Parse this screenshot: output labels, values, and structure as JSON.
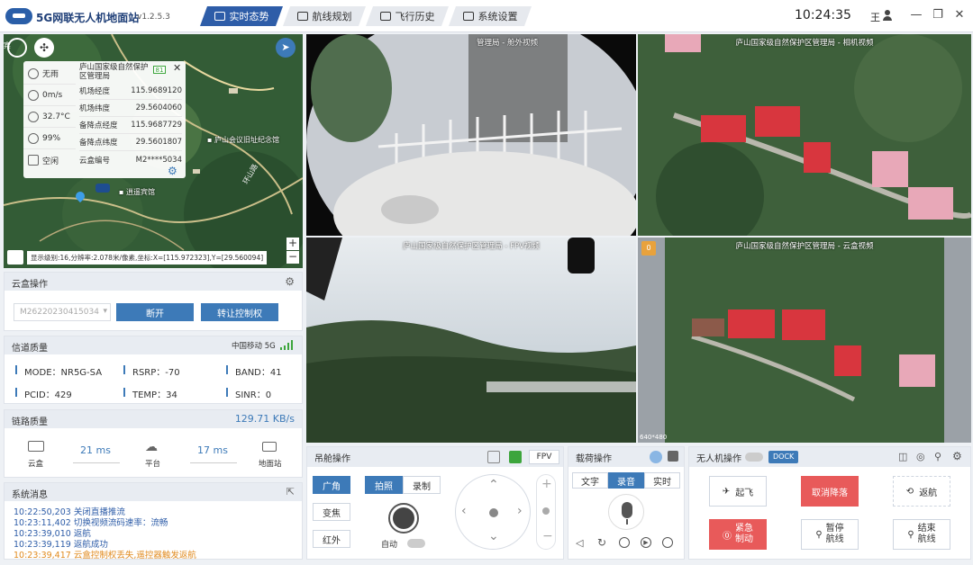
{
  "app": {
    "title": "5G网联无人机地面站",
    "version": "v1.2.5.3"
  },
  "nav": {
    "tabs": [
      "实时态势",
      "航线规划",
      "飞行历史",
      "系统设置"
    ],
    "active": "实时态势"
  },
  "header": {
    "clock": "10:24:35",
    "user": "王"
  },
  "window": {
    "min": "—",
    "max": "❐",
    "close": "✕"
  },
  "map": {
    "poi1": "庐山会议旧址纪念馆",
    "poi2": "逍遥宾馆",
    "road": "环山路",
    "scale_text": "显示级别:16,分辨率:2.078米/像素,坐标:X=[115.972323],Y=[29.560094]",
    "zoom_in": "+",
    "zoom_out": "−",
    "left_label": "宾"
  },
  "weather": {
    "rain": "无雨",
    "wind": "0m/s",
    "temp": "32.7°C",
    "humidity": "99%",
    "status": "空闲"
  },
  "dock_info": {
    "name": "庐山国家级自然保护区管理局",
    "badge": "81",
    "rows": [
      {
        "k": "机场经度",
        "v": "115.9689120"
      },
      {
        "k": "机场纬度",
        "v": "29.5604060"
      },
      {
        "k": "备降点经度",
        "v": "115.9687729"
      },
      {
        "k": "备降点纬度",
        "v": "29.5601807"
      },
      {
        "k": "云盒编号",
        "v": "M2****5034"
      }
    ]
  },
  "cloudbox": {
    "title": "云盒操作",
    "select_value": "M26220230415034",
    "disconnect": "断开",
    "transfer": "转让控制权"
  },
  "signal": {
    "title": "信道质量",
    "carrier": "中国移动 5G",
    "mode": "MODE：NR5G-SA",
    "rsrp": "RSRP：-70",
    "band": "BAND：41",
    "pcid": "PCID：429",
    "temp": "TEMP：34",
    "sinr": "SINR：0"
  },
  "link": {
    "title": "链路质量",
    "rate": "129.71 KB/s",
    "box_label": "云盒",
    "box_ms": "21 ms",
    "platform_label": "平台",
    "platform_ms": "17 ms",
    "ground_label": "地面站"
  },
  "syslog": {
    "title": "系统消息",
    "lines": [
      {
        "t": "10:22:50,203 关闭直播推流",
        "warn": false
      },
      {
        "t": "10:23:11,402 切换视频流码速率：流畅",
        "warn": false
      },
      {
        "t": "10:23:39,010 返航",
        "warn": false
      },
      {
        "t": "10:23:39,119 返航成功",
        "warn": false
      },
      {
        "t": "10:23:39,417 云盒控制权丢失,遥控器触发返航",
        "warn": true
      }
    ]
  },
  "videos": {
    "cabin_out": "管理局 - 舱外视频",
    "camera": "庐山国家级自然保护区管理局 - 相机视频",
    "fpv": "庐山国家级自然保护区管理局 - FPV视频",
    "cloud": "庐山国家级自然保护区管理局 - 云盒视频",
    "badge": "0",
    "resolution": "640*480"
  },
  "gimbal": {
    "title": "吊舱操作",
    "fpv": "FPV",
    "wide": "广角",
    "zoom": "变焦",
    "ir": "红外",
    "photo": "拍照",
    "record": "录制",
    "auto": "自动"
  },
  "payload": {
    "title": "载荷操作",
    "text": "文字",
    "audio": "录音",
    "live": "实时"
  },
  "drone": {
    "title": "无人机操作",
    "dock": "DOCK",
    "takeoff": "起飞",
    "cancel_land": "取消降落",
    "return": "返航",
    "emergency": "紧急\n制动",
    "pause": "暂停\n航线",
    "end": "结束\n航线"
  }
}
